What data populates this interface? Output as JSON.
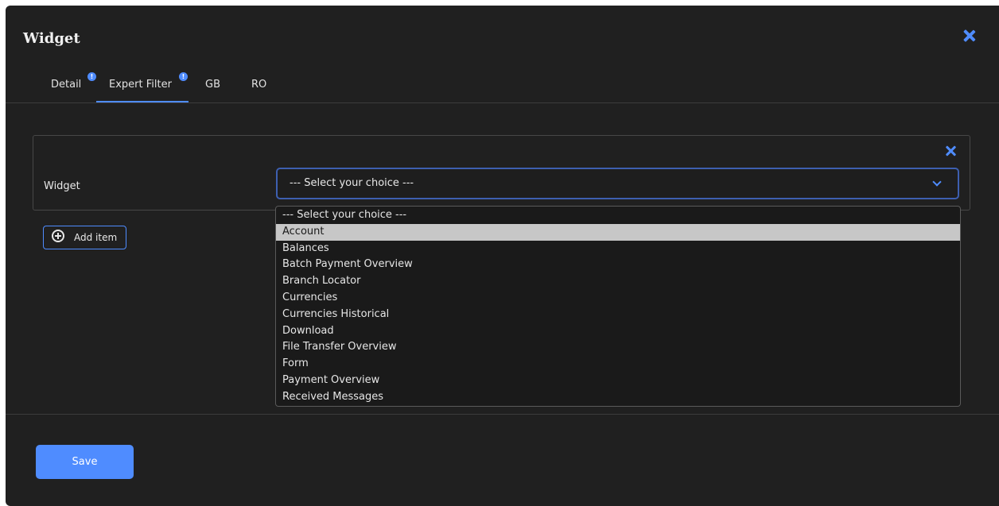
{
  "dialog": {
    "title": "Widget"
  },
  "tabs": [
    {
      "label": "Detail",
      "badge": "!"
    },
    {
      "label": "Expert Filter",
      "badge": "!"
    },
    {
      "label": "GB"
    },
    {
      "label": "RO"
    }
  ],
  "filter_item": {
    "field_label": "Widget",
    "select_value": "--- Select your choice ---"
  },
  "add_item_label": "Add item",
  "dropdown": {
    "options": [
      "--- Select your choice ---",
      "Account",
      "Balances",
      "Batch Payment Overview",
      "Branch Locator",
      "Currencies",
      "Currencies Historical",
      "Download",
      "File Transfer Overview",
      "Form",
      "Payment Overview",
      "Received Messages"
    ],
    "highlighted": "Account"
  },
  "save_label": "Save",
  "colors": {
    "accent": "#4f8cff",
    "background": "#202020",
    "highlight": "#c7c7c7"
  },
  "icons": {
    "close": "close-icon",
    "chevron": "chevron-down-icon",
    "add": "plus-circle-icon",
    "badge": "info-badge-icon"
  }
}
